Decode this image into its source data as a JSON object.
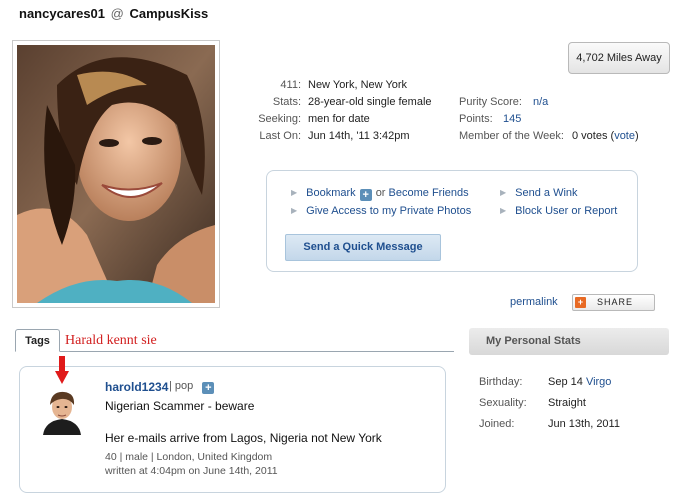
{
  "header": {
    "username": "nancycares01",
    "at": "@",
    "site": "CampusKiss"
  },
  "distance": "4,702 Miles Away",
  "info": {
    "left": [
      {
        "label": "411:",
        "value": "New York, New York"
      },
      {
        "label": "Stats:",
        "value": "28-year-old single female"
      },
      {
        "label": "Seeking:",
        "value": "men for date"
      },
      {
        "label": "Last On:",
        "value": "Jun 14th, '11 3:42pm"
      }
    ],
    "right": {
      "purity_label": "Purity Score:",
      "purity_value": "n/a",
      "points_label": "Points:",
      "points_value": "145",
      "motw_label": "Member of the Week:",
      "motw_votes": "0 votes (",
      "motw_vote_link": "vote",
      "motw_close": ")"
    }
  },
  "actions": {
    "bookmark": "Bookmark",
    "or_text": "or",
    "become_friends": "Become Friends",
    "give_access": "Give Access to my Private Photos",
    "send_wink": "Send a Wink",
    "block_user": "Block User or Report",
    "quick_message": "Send a Quick Message"
  },
  "permalink": "permalink",
  "share_label": "SHARE",
  "tags_tab": "Tags",
  "annotation": "Harald kennt sie",
  "comment": {
    "username": "harold1234",
    "separator": " | ",
    "tag": "pop",
    "title": "Nigerian Scammer - beware",
    "body": "Her e-mails arrive from Lagos, Nigeria not New York",
    "meta1": "40 | male | London, United Kingdom",
    "meta2": "written at 4:04pm on June 14th, 2011"
  },
  "personal_stats": {
    "title": "My Personal Stats",
    "rows": [
      {
        "label": "Birthday:",
        "value": "Sep 14",
        "link": "Virgo"
      },
      {
        "label": "Sexuality:",
        "value": "Straight",
        "link": ""
      },
      {
        "label": "Joined:",
        "value": "Jun 13th, 2011",
        "link": ""
      }
    ]
  },
  "colors": {
    "link": "#1f4f8f",
    "annotation": "#d21f1f",
    "panel_border": "#c8d4de"
  }
}
